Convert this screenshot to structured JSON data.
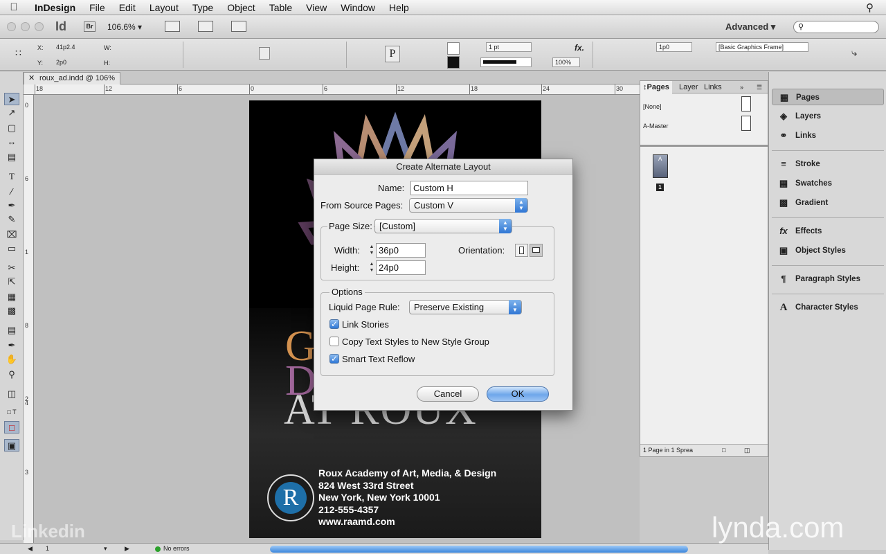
{
  "menubar": {
    "apple": "",
    "items": [
      "InDesign",
      "File",
      "Edit",
      "Layout",
      "Type",
      "Object",
      "Table",
      "View",
      "Window",
      "Help"
    ]
  },
  "appbar": {
    "logo": "Id",
    "bridge": "Br",
    "zoom": "106.6%",
    "workspace": "Advanced",
    "search_placeholder": ""
  },
  "control": {
    "x_label": "X:",
    "x_value": "41p2.4",
    "y_label": "Y:",
    "y_value": "2p0",
    "w_label": "W:",
    "h_label": "H:",
    "stroke_weight": "1 pt",
    "opacity": "100%",
    "offset": "1p0",
    "object_style": "[Basic Graphics Frame]"
  },
  "document": {
    "tab_title": "roux_ad.indd @ 106%",
    "ruler_top": [
      "18",
      "12",
      "6",
      "0",
      "6",
      "12",
      "18",
      "24",
      "30"
    ],
    "ruler_left": [
      "0",
      "6",
      "1",
      "8",
      "2",
      "4",
      "3"
    ]
  },
  "ad": {
    "word1": "G",
    "word2": "D",
    "word3": "AT ROUX",
    "address": [
      "Roux Academy of Art, Media, & Design",
      "824 West 33rd Street",
      "New York, New York 10001",
      "212-555-4357",
      "www.raamd.com"
    ],
    "seal_letter": "R"
  },
  "dialog": {
    "title": "Create Alternate Layout",
    "name_label": "Name:",
    "name_value": "Custom H",
    "source_label": "From Source Pages:",
    "source_value": "Custom V",
    "page_size_label": "Page Size:",
    "page_size_value": "[Custom]",
    "width_label": "Width:",
    "width_value": "36p0",
    "height_label": "Height:",
    "height_value": "24p0",
    "orientation_label": "Orientation:",
    "options_label": "Options",
    "liquid_label": "Liquid Page Rule:",
    "liquid_value": "Preserve Existing",
    "link_stories": "Link Stories",
    "link_stories_checked": true,
    "copy_styles": "Copy Text Styles to New Style Group",
    "copy_styles_checked": false,
    "smart_reflow": "Smart Text Reflow",
    "smart_reflow_checked": true,
    "cancel": "Cancel",
    "ok": "OK"
  },
  "pages_panel": {
    "tabs": [
      "Pages",
      "Layer",
      "Links"
    ],
    "none_master": "[None]",
    "a_master": "A-Master",
    "thumb_letter": "A",
    "page_number": "1",
    "footer": "1 Page in 1 Sprea"
  },
  "dock": {
    "items": [
      "Pages",
      "Layers",
      "Links",
      "Stroke",
      "Swatches",
      "Gradient",
      "Effects",
      "Object Styles",
      "Paragraph Styles",
      "Character Styles"
    ]
  },
  "status": {
    "page": "1",
    "errors": "No errors"
  },
  "watermarks": {
    "linkedin": "Linkedin",
    "lynda": "lynda.com"
  }
}
